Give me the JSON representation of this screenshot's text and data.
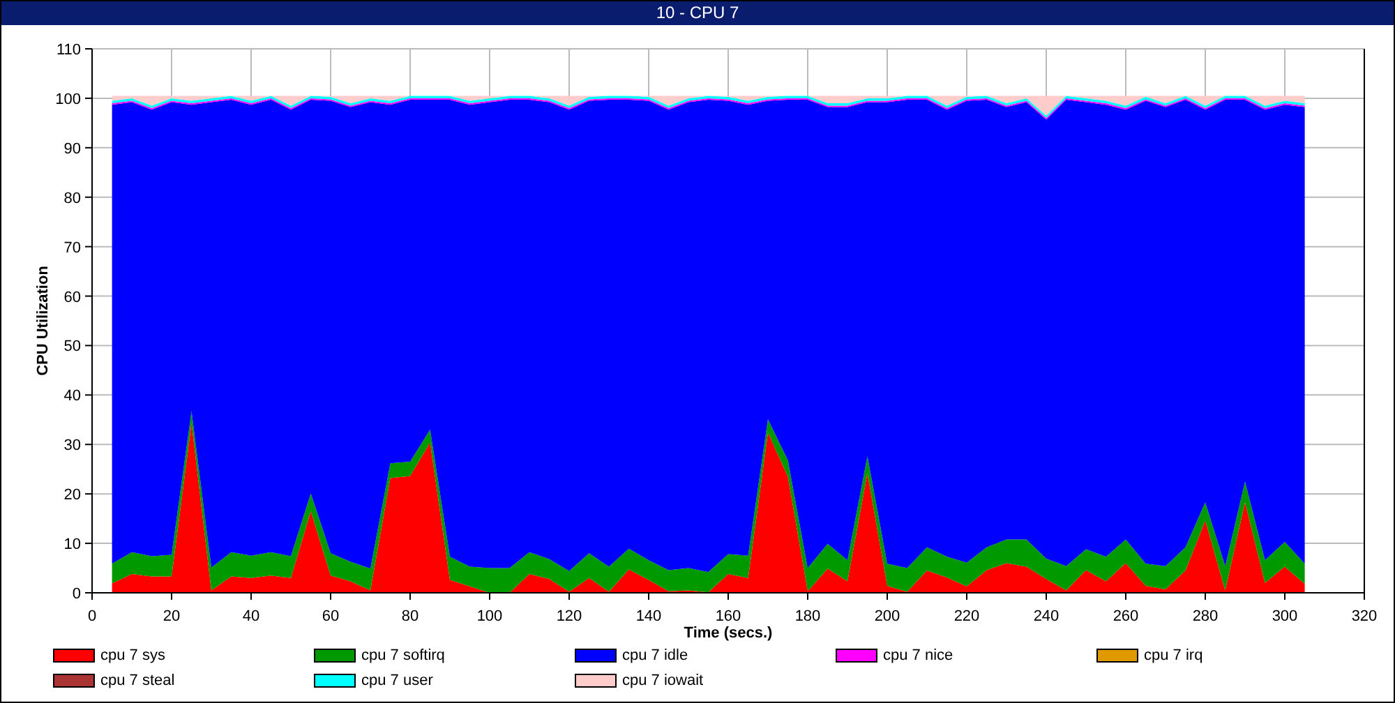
{
  "window": {
    "title": "10 - CPU 7"
  },
  "chart": {
    "chart_data": {
      "type": "area",
      "stacked": true,
      "grid": true,
      "xlabel": "Time (secs.)",
      "ylabel": "CPU Utilization",
      "xlim": [
        0,
        320
      ],
      "ylim": [
        0,
        110
      ],
      "xticks": [
        0,
        20,
        40,
        60,
        80,
        100,
        120,
        140,
        160,
        180,
        200,
        220,
        240,
        260,
        280,
        300,
        320
      ],
      "yticks": [
        0,
        10,
        20,
        30,
        40,
        50,
        60,
        70,
        80,
        90,
        100,
        110
      ],
      "x": [
        5,
        10,
        15,
        20,
        25,
        30,
        35,
        40,
        45,
        50,
        55,
        60,
        65,
        70,
        75,
        80,
        85,
        90,
        95,
        100,
        105,
        110,
        115,
        120,
        125,
        130,
        135,
        140,
        145,
        150,
        155,
        160,
        165,
        170,
        175,
        180,
        185,
        190,
        195,
        200,
        205,
        210,
        215,
        220,
        225,
        230,
        235,
        240,
        245,
        250,
        255,
        260,
        265,
        270,
        275,
        280,
        285,
        290,
        295,
        300,
        305
      ],
      "series": [
        {
          "name": "cpu 7 sys",
          "color": "#ff0000",
          "values": [
            1.9,
            3.8,
            3.3,
            3.3,
            34.3,
            0.5,
            3.3,
            3.0,
            3.5,
            3.0,
            16.5,
            3.5,
            2.3,
            0.5,
            23.2,
            23.6,
            30.4,
            2.6,
            1.3,
            0,
            0,
            3.8,
            2.8,
            0.2,
            3.0,
            0.2,
            4.7,
            2.6,
            0.3,
            0.5,
            0.1,
            3.8,
            3.0,
            32.4,
            23.5,
            0.3,
            4.9,
            2.3,
            24.2,
            1.4,
            0.2,
            4.5,
            3.1,
            1.3,
            4.6,
            6.0,
            5.3,
            2.8,
            0.5,
            4.6,
            2.3,
            6.0,
            1.4,
            0.7,
            4.5,
            14.6,
            0.5,
            18.3,
            2.0,
            5.3,
            1.8
          ]
        },
        {
          "name": "cpu 7 softirq",
          "color": "#009900",
          "values": [
            4.0,
            4.4,
            4.1,
            4.4,
            2.4,
            4.6,
            4.9,
            4.5,
            4.7,
            4.4,
            3.6,
            4.5,
            4.0,
            4.4,
            3.0,
            2.9,
            2.6,
            4.7,
            4.0,
            5.0,
            5.0,
            4.4,
            4.0,
            4.2,
            5.0,
            5.1,
            4.2,
            4.0,
            4.3,
            4.5,
            4.1,
            4.0,
            4.5,
            2.7,
            3.3,
            4.7,
            5.0,
            4.3,
            3.4,
            4.5,
            4.8,
            4.7,
            4.2,
            4.8,
            4.6,
            4.8,
            5.5,
            4.1,
            4.9,
            4.2,
            5.0,
            4.8,
            4.5,
            4.7,
            4.7,
            3.7,
            4.9,
            4.2,
            4.6,
            5.0,
            4.1
          ]
        },
        {
          "name": "cpu 7 idle",
          "color": "#0000ff",
          "values": [
            92.8,
            91.0,
            90.3,
            91.5,
            62.0,
            94.1,
            91.5,
            91.2,
            91.5,
            90.3,
            79.6,
            91.5,
            91.9,
            94.3,
            72.5,
            73.2,
            66.7,
            92.4,
            93.4,
            94.2,
            94.7,
            91.5,
            92.4,
            93.3,
            91.5,
            94.4,
            90.8,
            92.9,
            93.1,
            94.2,
            95.5,
            91.7,
            91.2,
            64.4,
            72.9,
            94.7,
            88.3,
            91.6,
            71.6,
            93.3,
            94.7,
            90.5,
            90.4,
            93.4,
            90.5,
            87.4,
            88.4,
            88.8,
            94.3,
            90.4,
            91.4,
            86.9,
            93.6,
            92.8,
            90.5,
            79.4,
            94.3,
            77.2,
            91.1,
            88.4,
            92.3
          ]
        },
        {
          "name": "cpu 7 nice",
          "color": "#ff00ff",
          "values": [
            0.3,
            0.3,
            0.3,
            0.3,
            0.3,
            0.3,
            0.3,
            0.3,
            0.3,
            0.3,
            0.3,
            0.3,
            0.3,
            0.3,
            0.3,
            0.3,
            0.3,
            0.3,
            0.3,
            0.3,
            0.3,
            0.3,
            0.3,
            0.3,
            0.3,
            0.3,
            0.3,
            0.3,
            0.3,
            0.3,
            0.3,
            0.3,
            0.3,
            0.3,
            0.3,
            0.3,
            0.3,
            0.3,
            0.3,
            0.3,
            0.3,
            0.3,
            0.3,
            0.3,
            0.3,
            0.3,
            0.3,
            0.3,
            0.3,
            0.3,
            0.3,
            0.3,
            0.3,
            0.3,
            0.3,
            0.3,
            0.3,
            0.3,
            0.3,
            0.3,
            0.3
          ]
        },
        {
          "name": "cpu 7 irq",
          "color": "#e09a00",
          "values": [
            null,
            null,
            null,
            null,
            null,
            null,
            null,
            null,
            null,
            null,
            null,
            null,
            null,
            null,
            null,
            null,
            null,
            null,
            null,
            null,
            null,
            null,
            null,
            null,
            null,
            null,
            null,
            null,
            null,
            null,
            null,
            null,
            null,
            null,
            null,
            null,
            null,
            null,
            null,
            null,
            null,
            null,
            null,
            null,
            null,
            null,
            null,
            null,
            null,
            null,
            null,
            null,
            null,
            null,
            null,
            null,
            null,
            null,
            null,
            null,
            null
          ]
        },
        {
          "name": "cpu 7 steal",
          "color": "#aa3333",
          "values": [
            null,
            null,
            null,
            null,
            null,
            null,
            null,
            null,
            null,
            null,
            null,
            null,
            null,
            null,
            null,
            null,
            null,
            null,
            null,
            null,
            null,
            null,
            null,
            null,
            null,
            null,
            null,
            null,
            null,
            null,
            null,
            null,
            null,
            null,
            null,
            null,
            null,
            null,
            null,
            null,
            null,
            null,
            null,
            null,
            null,
            null,
            null,
            null,
            null,
            null,
            null,
            null,
            null,
            null,
            null,
            null,
            null,
            null,
            null,
            null,
            null
          ]
        },
        {
          "name": "cpu 7 user",
          "color": "#00ffff",
          "values": [
            0.5,
            0.5,
            0.5,
            0.5,
            0.5,
            0.5,
            0.5,
            0.5,
            0.5,
            0.5,
            0.5,
            0.5,
            0.5,
            0.5,
            0.5,
            0.5,
            0.5,
            0.5,
            0.5,
            0.5,
            0.5,
            0.5,
            0.5,
            0.5,
            0.5,
            0.5,
            0.5,
            0.5,
            0.5,
            0.5,
            0.5,
            0.5,
            0.5,
            0.5,
            0.5,
            0.5,
            0.5,
            0.5,
            0.5,
            0.5,
            0.5,
            0.5,
            0.5,
            0.5,
            0.5,
            0.5,
            0.5,
            0.5,
            0.5,
            0.5,
            0.5,
            0.5,
            0.5,
            0.5,
            0.5,
            0.5,
            0.5,
            0.5,
            0.5,
            0.5,
            0.5
          ]
        },
        {
          "name": "cpu 7 iowait",
          "color": "#ffcccc",
          "values": [
            1,
            0.5,
            2,
            0.5,
            1,
            0.5,
            0,
            1,
            0,
            2,
            0,
            0.2,
            1.5,
            0.5,
            1,
            0,
            0,
            0,
            1,
            0.5,
            0,
            0,
            0.5,
            2,
            0.2,
            0,
            0,
            0.2,
            2,
            0.5,
            0,
            0.2,
            1,
            0.2,
            0,
            0,
            1.5,
            1.5,
            0.5,
            0.5,
            0,
            0,
            2,
            0.2,
            0,
            1.5,
            0.5,
            4,
            0,
            0.5,
            1,
            2,
            0.2,
            1.5,
            0,
            2,
            0,
            0,
            2,
            1,
            1.5
          ]
        }
      ]
    }
  }
}
